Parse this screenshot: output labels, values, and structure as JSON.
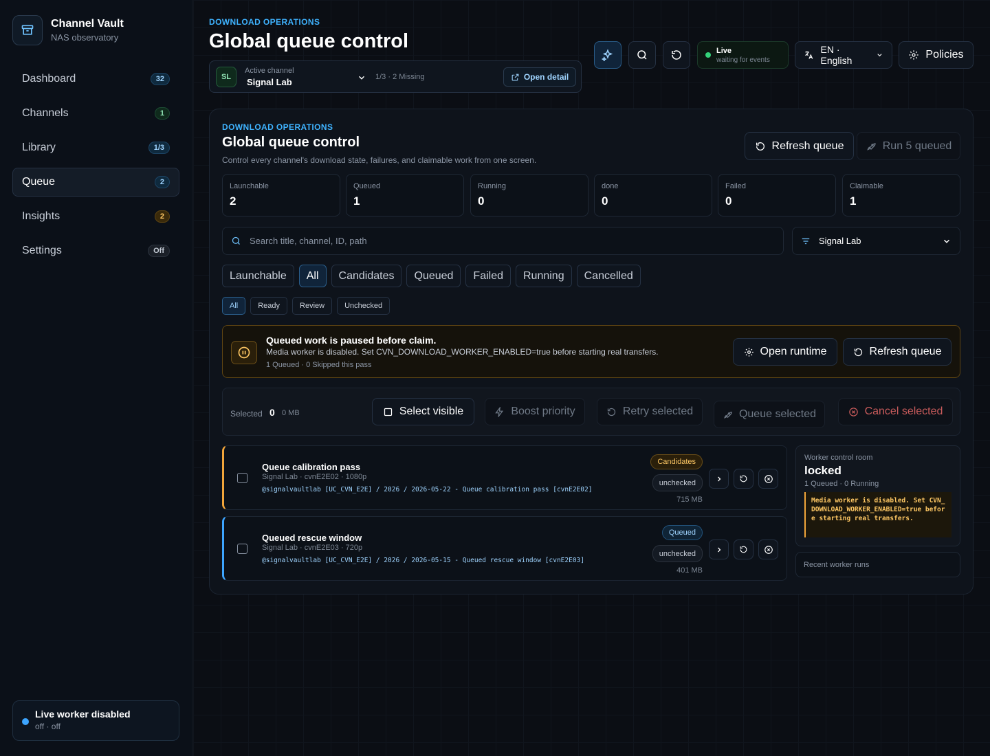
{
  "brand": {
    "title": "Channel Vault",
    "subtitle": "NAS observatory"
  },
  "nav": [
    {
      "label": "Dashboard",
      "badge": "32",
      "tone": "blue"
    },
    {
      "label": "Channels",
      "badge": "1",
      "tone": "green"
    },
    {
      "label": "Library",
      "badge": "1/3",
      "tone": "blue"
    },
    {
      "label": "Queue",
      "badge": "2",
      "tone": "blue",
      "active": true
    },
    {
      "label": "Insights",
      "badge": "2",
      "tone": "amber"
    },
    {
      "label": "Settings",
      "badge": "Off",
      "tone": "gray"
    }
  ],
  "live_worker": {
    "title": "Live worker disabled",
    "subtitle": "off · off"
  },
  "header": {
    "eyebrow": "DOWNLOAD OPERATIONS",
    "title": "Global queue control",
    "channel": {
      "avatar": "SL",
      "label": "Active channel",
      "name": "Signal Lab",
      "meta": "1/3 · 2 Missing",
      "open_detail": "Open detail"
    },
    "live": {
      "title": "Live",
      "subtitle": "waiting for events"
    },
    "language": "EN · English",
    "policies": "Policies"
  },
  "panel": {
    "eyebrow": "DOWNLOAD OPERATIONS",
    "title": "Global queue control",
    "description": "Control every channel's download state, failures, and claimable work from one screen.",
    "refresh_queue": "Refresh queue",
    "run_queued": "Run 5 queued",
    "stats": [
      {
        "label": "Launchable",
        "value": "2"
      },
      {
        "label": "Queued",
        "value": "1"
      },
      {
        "label": "Running",
        "value": "0"
      },
      {
        "label": "done",
        "value": "0"
      },
      {
        "label": "Failed",
        "value": "0"
      },
      {
        "label": "Claimable",
        "value": "1"
      }
    ],
    "search_placeholder": "Search title, channel, ID, path",
    "channel_filter": "Signal Lab",
    "tabs": [
      "Launchable",
      "All",
      "Candidates",
      "Queued",
      "Failed",
      "Running",
      "Cancelled"
    ],
    "active_tab": "All",
    "subtabs": [
      "All",
      "Ready",
      "Review",
      "Unchecked"
    ],
    "active_subtab": "All",
    "alert": {
      "title": "Queued work is paused before claim.",
      "message": "Media worker is disabled. Set CVN_DOWNLOAD_WORKER_ENABLED=true before starting real transfers.",
      "meta": "1 Queued · 0 Skipped this pass",
      "open_runtime": "Open runtime",
      "refresh_queue": "Refresh queue"
    },
    "bulk": {
      "label": "Selected",
      "count": "0",
      "size": "0 MB",
      "select_visible": "Select visible",
      "boost": "Boost priority",
      "retry": "Retry selected",
      "queue": "Queue selected",
      "cancel": "Cancel selected"
    },
    "items": [
      {
        "title": "Queue calibration pass",
        "meta": "Signal Lab · cvnE2E02 · 1080p",
        "path": "@signalvaultlab [UC_CVN_E2E] / 2026 / 2026-05-22 - Queue calibration pass [cvnE2E02]",
        "status": "Candidates",
        "check": "unchecked",
        "size": "715 MB"
      },
      {
        "title": "Queued rescue window",
        "meta": "Signal Lab · cvnE2E03 · 720p",
        "path": "@signalvaultlab [UC_CVN_E2E] / 2026 / 2026-05-15 - Queued rescue window [cvnE2E03]",
        "status": "Queued",
        "check": "unchecked",
        "size": "401 MB"
      }
    ],
    "worker": {
      "label": "Worker control room",
      "state": "locked",
      "meta": "1 Queued · 0 Running",
      "message": "Media worker is disabled. Set CVN_DOWNLOAD_WORKER_ENABLED=true before starting real transfers."
    },
    "recent_runs": "Recent worker runs"
  }
}
